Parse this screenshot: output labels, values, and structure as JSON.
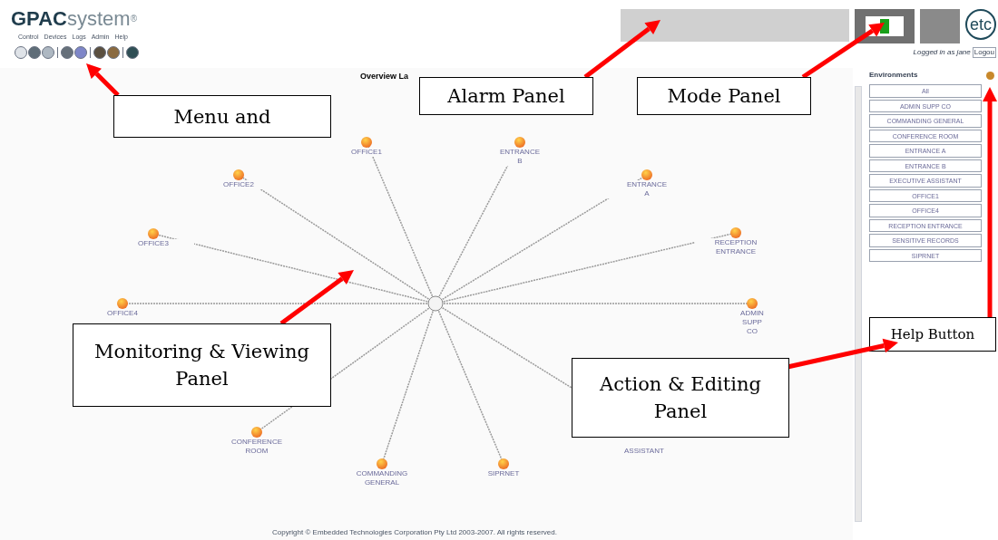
{
  "header": {
    "logo": {
      "bold": "GPAC",
      "light": "system",
      "mark": "®"
    },
    "menu": [
      "Control",
      "Devices",
      "Logs",
      "Admin",
      "Help"
    ],
    "logo_badge": "etc",
    "user": {
      "text": "Logged in as jane",
      "logout": "Logou"
    }
  },
  "canvas": {
    "title": "Overview La",
    "footer": "Copyright © Embedded Technologies Corporation Pty Ltd 2003-2007. All rights reserved.",
    "nodes": [
      {
        "lines": [
          "OFFICE1"
        ]
      },
      {
        "lines": [
          "ENTRANCE",
          "B"
        ]
      },
      {
        "lines": [
          "ENTRANCE",
          "A"
        ]
      },
      {
        "lines": [
          "RECEPTION",
          "ENTRANCE"
        ]
      },
      {
        "lines": [
          "ADMIN",
          "SUPP",
          "CO"
        ]
      },
      {
        "lines": [
          "SIPRNET"
        ]
      },
      {
        "lines": [
          "COMMANDING",
          "GENERAL"
        ]
      },
      {
        "lines": [
          "CONFERENCE",
          "ROOM"
        ]
      },
      {
        "lines": [
          "OFFICE4"
        ]
      },
      {
        "lines": [
          "OFFICE3"
        ]
      },
      {
        "lines": [
          "OFFICE2"
        ]
      }
    ],
    "partial_label": "ASSISTANT"
  },
  "sidebar": {
    "title": "Environments",
    "items": [
      "All",
      "ADMIN SUPP CO",
      "COMMANDING GENERAL",
      "CONFERENCE ROOM",
      "ENTRANCE A",
      "ENTRANCE B",
      "EXECUTIVE ASSISTANT",
      "OFFICE1",
      "OFFICE4",
      "RECEPTION ENTRANCE",
      "SENSITIVE RECORDS",
      "SIPRNET"
    ]
  },
  "callouts": [
    "Menu and",
    "Alarm Panel",
    "Mode Panel",
    "Help Button",
    "Monitoring & Viewing  Panel",
    "Action & Editing Panel"
  ]
}
